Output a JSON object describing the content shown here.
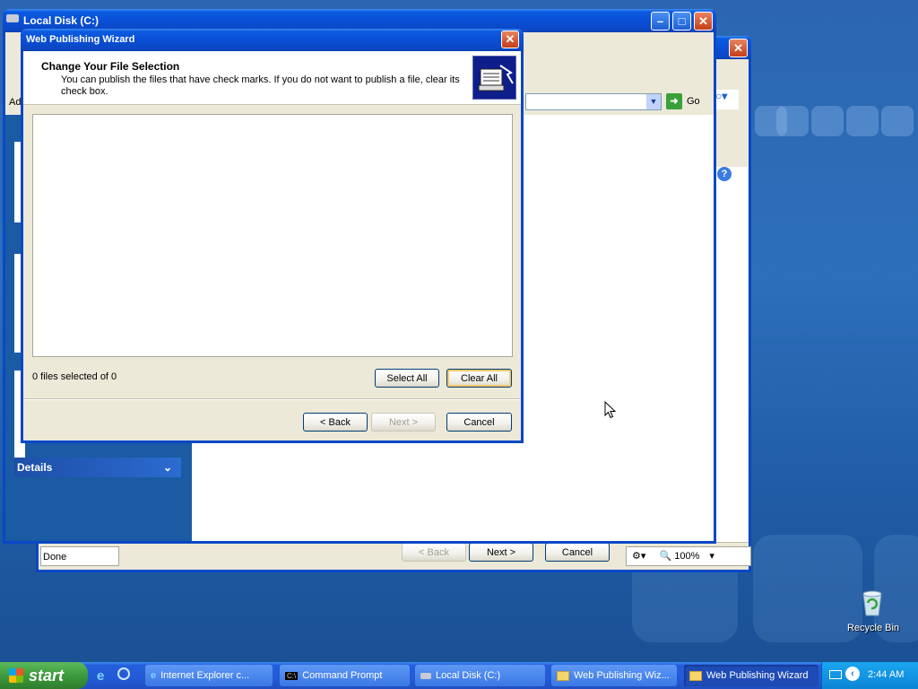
{
  "colors": {
    "xp_blue": "#0a47c7",
    "desktop": "#2d6fbb",
    "explorer_panel": "#1a5ba4"
  },
  "ie_window": {
    "status_text": "Done",
    "zoom_label": "100%",
    "back_label": "< Back",
    "next_label": "Next >",
    "cancel_label": "Cancel"
  },
  "explorer": {
    "title": "Local Disk (C:)",
    "address_label": "Ad",
    "go_label": "Go",
    "details_label": "Details"
  },
  "wizard": {
    "title": "Web Publishing Wizard",
    "heading": "Change Your File Selection",
    "subheading": "You can publish the files that have check marks.  If you do not want to publish a file, clear its check box.",
    "files_status": "0 files selected of 0",
    "select_all_label": "Select All",
    "clear_all_label": "Clear All",
    "back_label": "< Back",
    "next_label": "Next >",
    "cancel_label": "Cancel"
  },
  "desktop": {
    "recycle_bin_label": "Recycle Bin"
  },
  "taskbar": {
    "start_label": "start",
    "items": [
      {
        "label": "Internet Explorer c...",
        "icon": "ie-icon"
      },
      {
        "label": "Command Prompt",
        "icon": "cmd-icon"
      },
      {
        "label": "Local Disk (C:)",
        "icon": "drive-icon"
      },
      {
        "label": "Web Publishing Wiz...",
        "icon": "folder-icon"
      },
      {
        "label": "Web Publishing Wizard",
        "icon": "folder-icon",
        "active": true
      }
    ],
    "clock": "2:44 AM"
  }
}
